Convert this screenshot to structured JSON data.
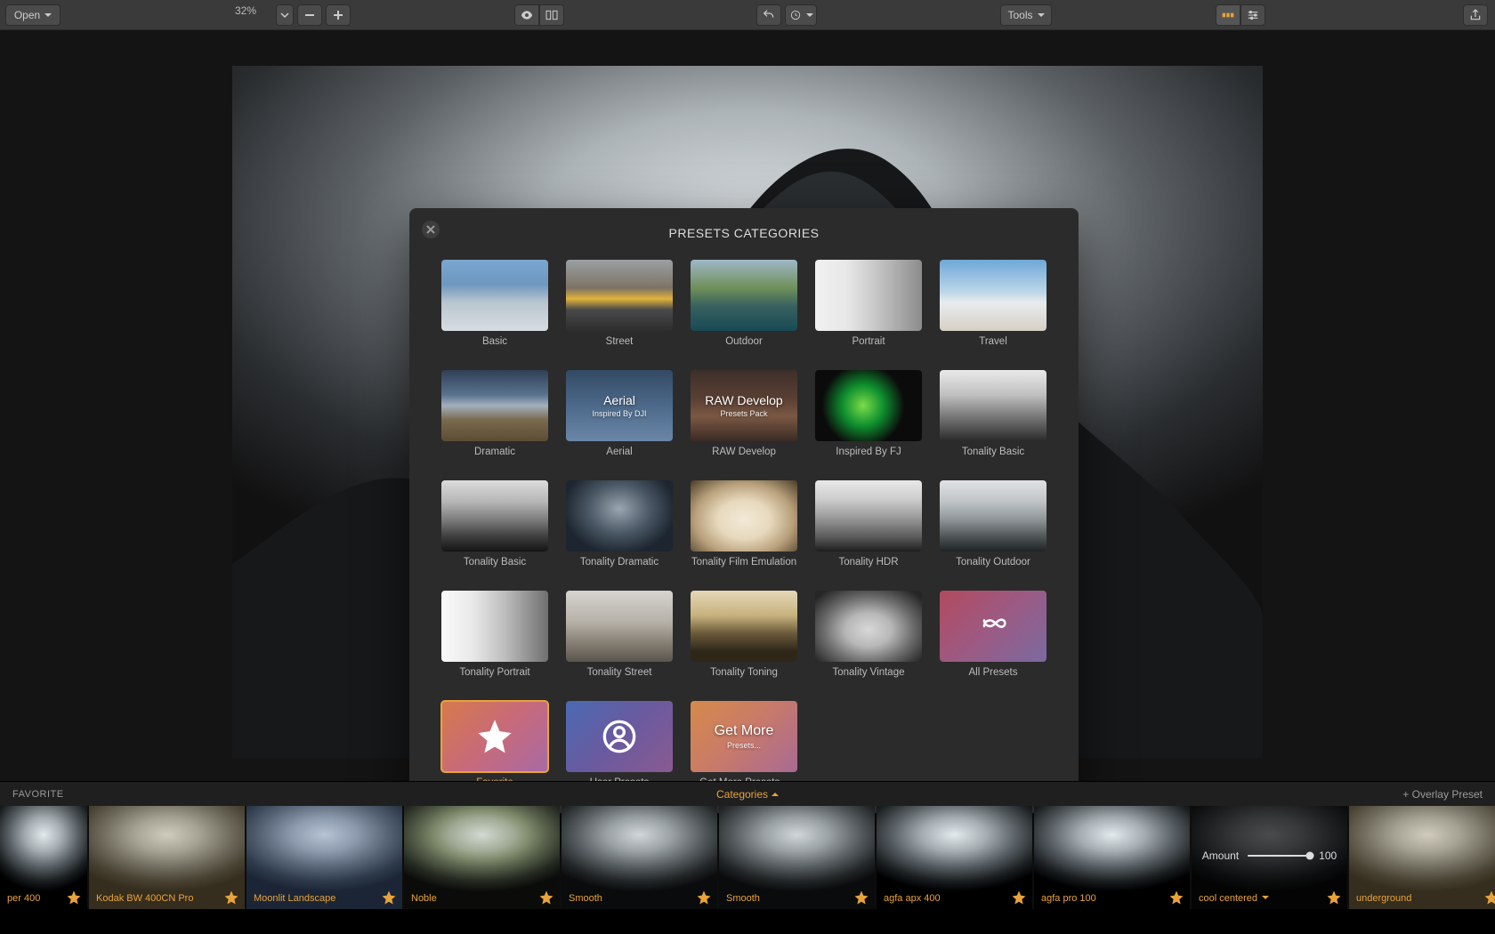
{
  "toolbar": {
    "open_label": "Open",
    "zoom_level": "32%",
    "tools_label": "Tools"
  },
  "modal": {
    "title": "PRESETS CATEGORIES",
    "categories": [
      {
        "label": "Basic"
      },
      {
        "label": "Street"
      },
      {
        "label": "Outdoor"
      },
      {
        "label": "Portrait"
      },
      {
        "label": "Travel"
      },
      {
        "label": "Dramatic"
      },
      {
        "label": "Aerial",
        "overlay_title": "Aerial",
        "overlay_sub": "Inspired By DJI"
      },
      {
        "label": "RAW Develop",
        "overlay_title": "RAW Develop",
        "overlay_sub": "Presets Pack"
      },
      {
        "label": "Inspired By FJ"
      },
      {
        "label": "Tonality Basic"
      },
      {
        "label": "Tonality Basic"
      },
      {
        "label": "Tonality Dramatic"
      },
      {
        "label": "Tonality Film Emulation"
      },
      {
        "label": "Tonality HDR"
      },
      {
        "label": "Tonality Outdoor"
      },
      {
        "label": "Tonality Portrait"
      },
      {
        "label": "Tonality Street"
      },
      {
        "label": "Tonality Toning"
      },
      {
        "label": "Tonality Vintage"
      },
      {
        "label": "All Presets"
      },
      {
        "label": "Favorite"
      },
      {
        "label": "User Presets"
      },
      {
        "label": "Get More Presets...",
        "overlay_title": "Get More",
        "overlay_sub": "Presets..."
      }
    ]
  },
  "strip": {
    "section_title": "FAVORITE",
    "categories_label": "Categories",
    "overlay_label": "+ Overlay Preset",
    "amount_label": "Amount",
    "amount_value": "100",
    "presets": [
      {
        "label": "per 400"
      },
      {
        "label": "Kodak BW 400CN Pro"
      },
      {
        "label": "Moonlit Landscape"
      },
      {
        "label": "Noble"
      },
      {
        "label": "Smooth"
      },
      {
        "label": "Smooth"
      },
      {
        "label": "agfa apx 400"
      },
      {
        "label": "agfa pro 100"
      },
      {
        "label": "cool centered"
      },
      {
        "label": "underground"
      }
    ]
  }
}
